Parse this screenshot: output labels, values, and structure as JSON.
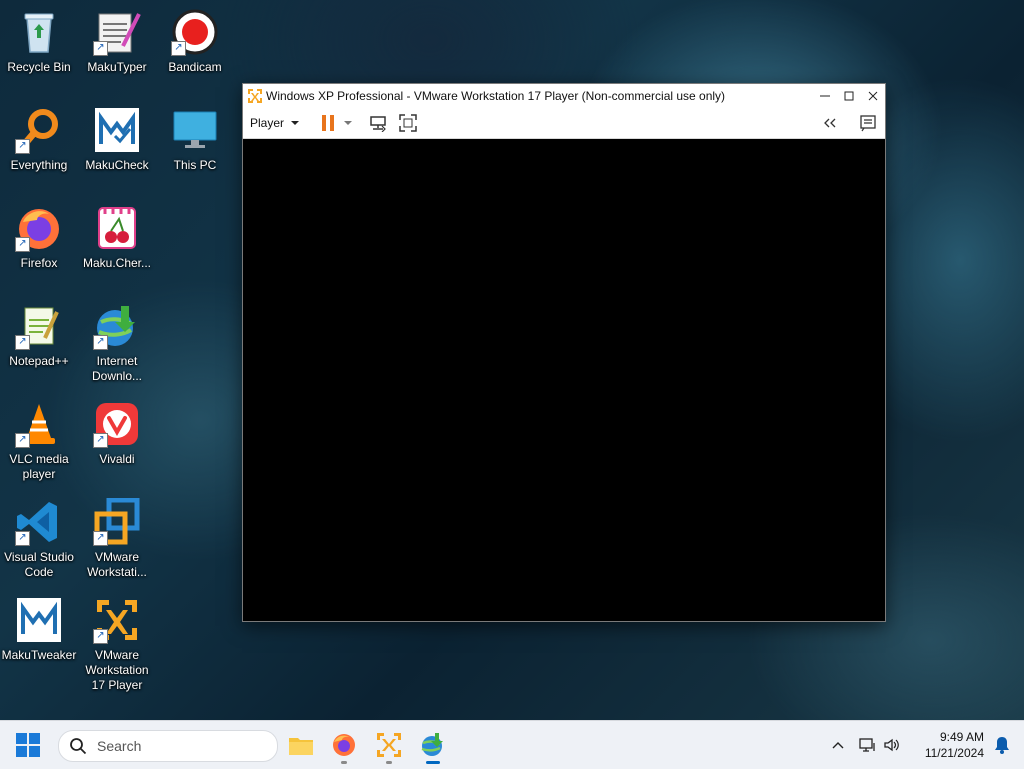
{
  "desktop": {
    "icons": [
      {
        "label": "Recycle Bin"
      },
      {
        "label": "MakuTyper"
      },
      {
        "label": "Bandicam"
      },
      {
        "label": "Everything"
      },
      {
        "label": "MakuCheck"
      },
      {
        "label": "This PC"
      },
      {
        "label": "Firefox"
      },
      {
        "label": "Maku.Cher..."
      },
      {
        "label": "Notepad++"
      },
      {
        "label": "Internet Downlo..."
      },
      {
        "label": "VLC media player"
      },
      {
        "label": "Vivaldi"
      },
      {
        "label": "Visual Studio Code"
      },
      {
        "label": "VMware Workstati..."
      },
      {
        "label": "MakuTweaker"
      },
      {
        "label": "VMware Workstation 17 Player"
      }
    ]
  },
  "vm_window": {
    "title": "Windows XP Professional - VMware Workstation 17 Player (Non-commercial use only)",
    "player_menu_label": "Player",
    "colors": {
      "pause": "#e8741c",
      "screen": "#000000"
    }
  },
  "taskbar": {
    "search_placeholder": "Search",
    "time": "9:49 AM",
    "date": "11/21/2024",
    "apps": [
      "file-explorer-icon",
      "firefox-icon",
      "vmware-player-icon",
      "internet-download-manager-icon"
    ]
  }
}
